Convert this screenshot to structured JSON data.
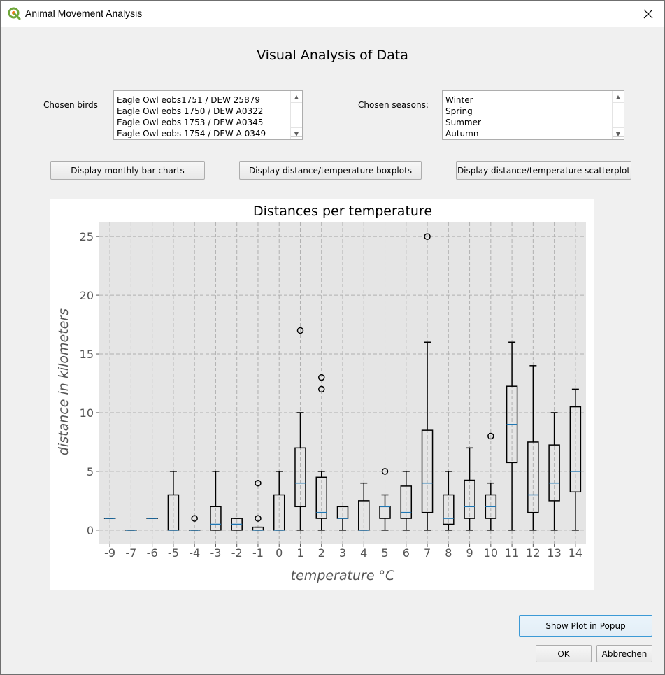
{
  "window": {
    "title": "Animal Movement Analysis",
    "app_icon": "qgis-logo-icon",
    "close_icon": "close-icon"
  },
  "heading": "Visual Analysis of Data",
  "birds": {
    "label": "Chosen birds",
    "items": [
      "Eagle Owl eobs1751 / DEW 25879",
      "Eagle Owl eobs 1750 / DEW A0322",
      "Eagle Owl eobs 1753 / DEW A0345",
      "Eagle Owl eobs 1754 / DEW A 0349"
    ]
  },
  "seasons": {
    "label": "Chosen seasons:",
    "items": [
      "Winter",
      "Spring",
      "Summer",
      "Autumn"
    ]
  },
  "buttons": {
    "bar_charts": "Display monthly bar charts",
    "boxplots": "Display distance/temperature boxplots",
    "scatterplot": "Display distance/temperature scatterplot",
    "popup": "Show Plot in Popup",
    "ok": "OK",
    "cancel": "Abbrechen"
  },
  "colors": {
    "plot_bg": "#e5e5e5",
    "grid": "#b0b0b0",
    "box": "#000000",
    "median": "#1f77b4",
    "focus_border": "#3c9ad6"
  },
  "chart_data": {
    "type": "boxplot",
    "title": "Distances per temperature",
    "xlabel": "temperature °C",
    "ylabel": "distance in kilometers",
    "ylim": [
      -1.2,
      26.2
    ],
    "yticks": [
      0,
      5,
      10,
      15,
      20,
      25
    ],
    "grid": true,
    "categories": [
      "-9",
      "-7",
      "-6",
      "-5",
      "-4",
      "-3",
      "-2",
      "-1",
      "0",
      "1",
      "2",
      "3",
      "4",
      "5",
      "6",
      "7",
      "8",
      "9",
      "10",
      "11",
      "12",
      "13",
      "14"
    ],
    "boxes": [
      {
        "min": 1,
        "q1": 1,
        "median": 1,
        "q3": 1,
        "max": 1,
        "outliers": []
      },
      {
        "min": 0,
        "q1": 0,
        "median": 0,
        "q3": 0,
        "max": 0,
        "outliers": []
      },
      {
        "min": 1,
        "q1": 1,
        "median": 1,
        "q3": 1,
        "max": 1,
        "outliers": []
      },
      {
        "min": 0,
        "q1": 0,
        "median": 0,
        "q3": 3,
        "max": 5,
        "outliers": []
      },
      {
        "min": 0,
        "q1": 0,
        "median": 0,
        "q3": 0,
        "max": 0,
        "outliers": [
          1
        ]
      },
      {
        "min": 0,
        "q1": 0,
        "median": 0.5,
        "q3": 2,
        "max": 5,
        "outliers": []
      },
      {
        "min": 0,
        "q1": 0,
        "median": 0.5,
        "q3": 1,
        "max": 1,
        "outliers": []
      },
      {
        "min": 0,
        "q1": 0,
        "median": 0,
        "q3": 0.25,
        "max": 0.25,
        "outliers": [
          1,
          4
        ]
      },
      {
        "min": 0,
        "q1": 0,
        "median": 0,
        "q3": 3,
        "max": 5,
        "outliers": []
      },
      {
        "min": 0,
        "q1": 2,
        "median": 4,
        "q3": 7,
        "max": 10,
        "outliers": [
          17
        ]
      },
      {
        "min": 0,
        "q1": 1,
        "median": 1.5,
        "q3": 4.5,
        "max": 5,
        "outliers": [
          12,
          13
        ]
      },
      {
        "min": 0,
        "q1": 1,
        "median": 1,
        "q3": 2,
        "max": 2,
        "outliers": []
      },
      {
        "min": 0,
        "q1": 0,
        "median": 0,
        "q3": 2.5,
        "max": 4,
        "outliers": []
      },
      {
        "min": 0,
        "q1": 1,
        "median": 2,
        "q3": 2,
        "max": 3,
        "outliers": [
          5
        ]
      },
      {
        "min": 0,
        "q1": 1,
        "median": 1.5,
        "q3": 3.75,
        "max": 5,
        "outliers": []
      },
      {
        "min": 0,
        "q1": 1.5,
        "median": 4,
        "q3": 8.5,
        "max": 16,
        "outliers": [
          25
        ]
      },
      {
        "min": 0,
        "q1": 0.5,
        "median": 1,
        "q3": 3,
        "max": 5,
        "outliers": []
      },
      {
        "min": 0,
        "q1": 1,
        "median": 2,
        "q3": 4.25,
        "max": 7,
        "outliers": []
      },
      {
        "min": 0,
        "q1": 1,
        "median": 2,
        "q3": 3,
        "max": 4,
        "outliers": [
          8
        ]
      },
      {
        "min": 0,
        "q1": 5.75,
        "median": 9,
        "q3": 12.25,
        "max": 16,
        "outliers": []
      },
      {
        "min": 0,
        "q1": 1.5,
        "median": 3,
        "q3": 7.5,
        "max": 14,
        "outliers": []
      },
      {
        "min": 0,
        "q1": 2.5,
        "median": 4,
        "q3": 7.25,
        "max": 10,
        "outliers": []
      },
      {
        "min": 0,
        "q1": 3.25,
        "median": 5,
        "q3": 10.5,
        "max": 12,
        "outliers": []
      }
    ]
  }
}
